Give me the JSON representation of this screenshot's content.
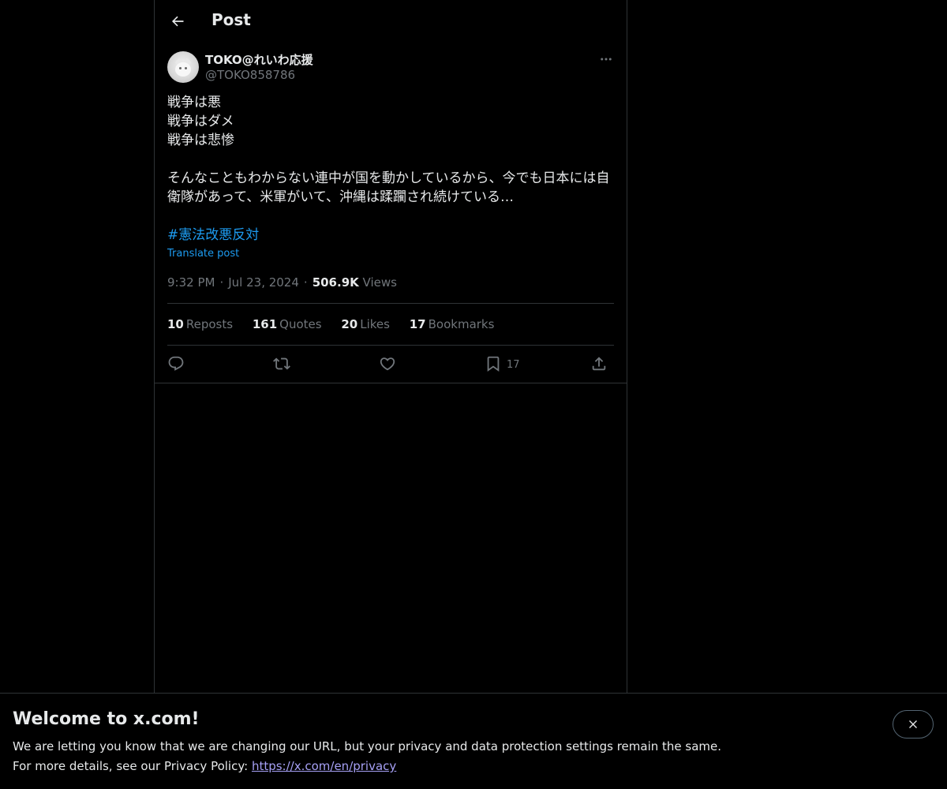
{
  "header": {
    "title": "Post"
  },
  "author": {
    "display_name": "TOKO@れいわ応援",
    "handle": "@TOKO858786"
  },
  "tweet": {
    "lines": [
      "戦争は悪",
      "戦争はダメ",
      "戦争は悲惨",
      "",
      "そんなこともわからない連中が国を動かしているから、今でも日本には自衛隊があって、米軍がいて、沖縄は蹂躙され続けている…"
    ],
    "hashtag": "#憲法改悪反対",
    "translate_label": "Translate post"
  },
  "meta": {
    "time": "9:32 PM",
    "date": "Jul 23, 2024",
    "views_count": "506.9K",
    "views_label": "Views"
  },
  "stats": {
    "reposts_count": "10",
    "reposts_label": "Reposts",
    "quotes_count": "161",
    "quotes_label": "Quotes",
    "likes_count": "20",
    "likes_label": "Likes",
    "bookmarks_count": "17",
    "bookmarks_label": "Bookmarks"
  },
  "actions": {
    "bookmark_count": "17"
  },
  "icons": {
    "back": "arrow-left-icon",
    "more": "more-horizontal-icon",
    "reply": "reply-icon",
    "repost": "repost-icon",
    "like": "heart-icon",
    "bookmark": "bookmark-icon",
    "share": "share-icon",
    "close": "close-icon"
  },
  "colors": {
    "accent": "#1d9bf0",
    "muted": "#71767b",
    "text": "#e7e9ea",
    "link": "#a6a0f5"
  },
  "banner": {
    "title": "Welcome to x.com!",
    "line1": "We are letting you know that we are changing our URL, but your privacy and data protection settings remain the same.",
    "line2_prefix": "For more details, see our Privacy Policy: ",
    "link": "https://x.com/en/privacy"
  }
}
